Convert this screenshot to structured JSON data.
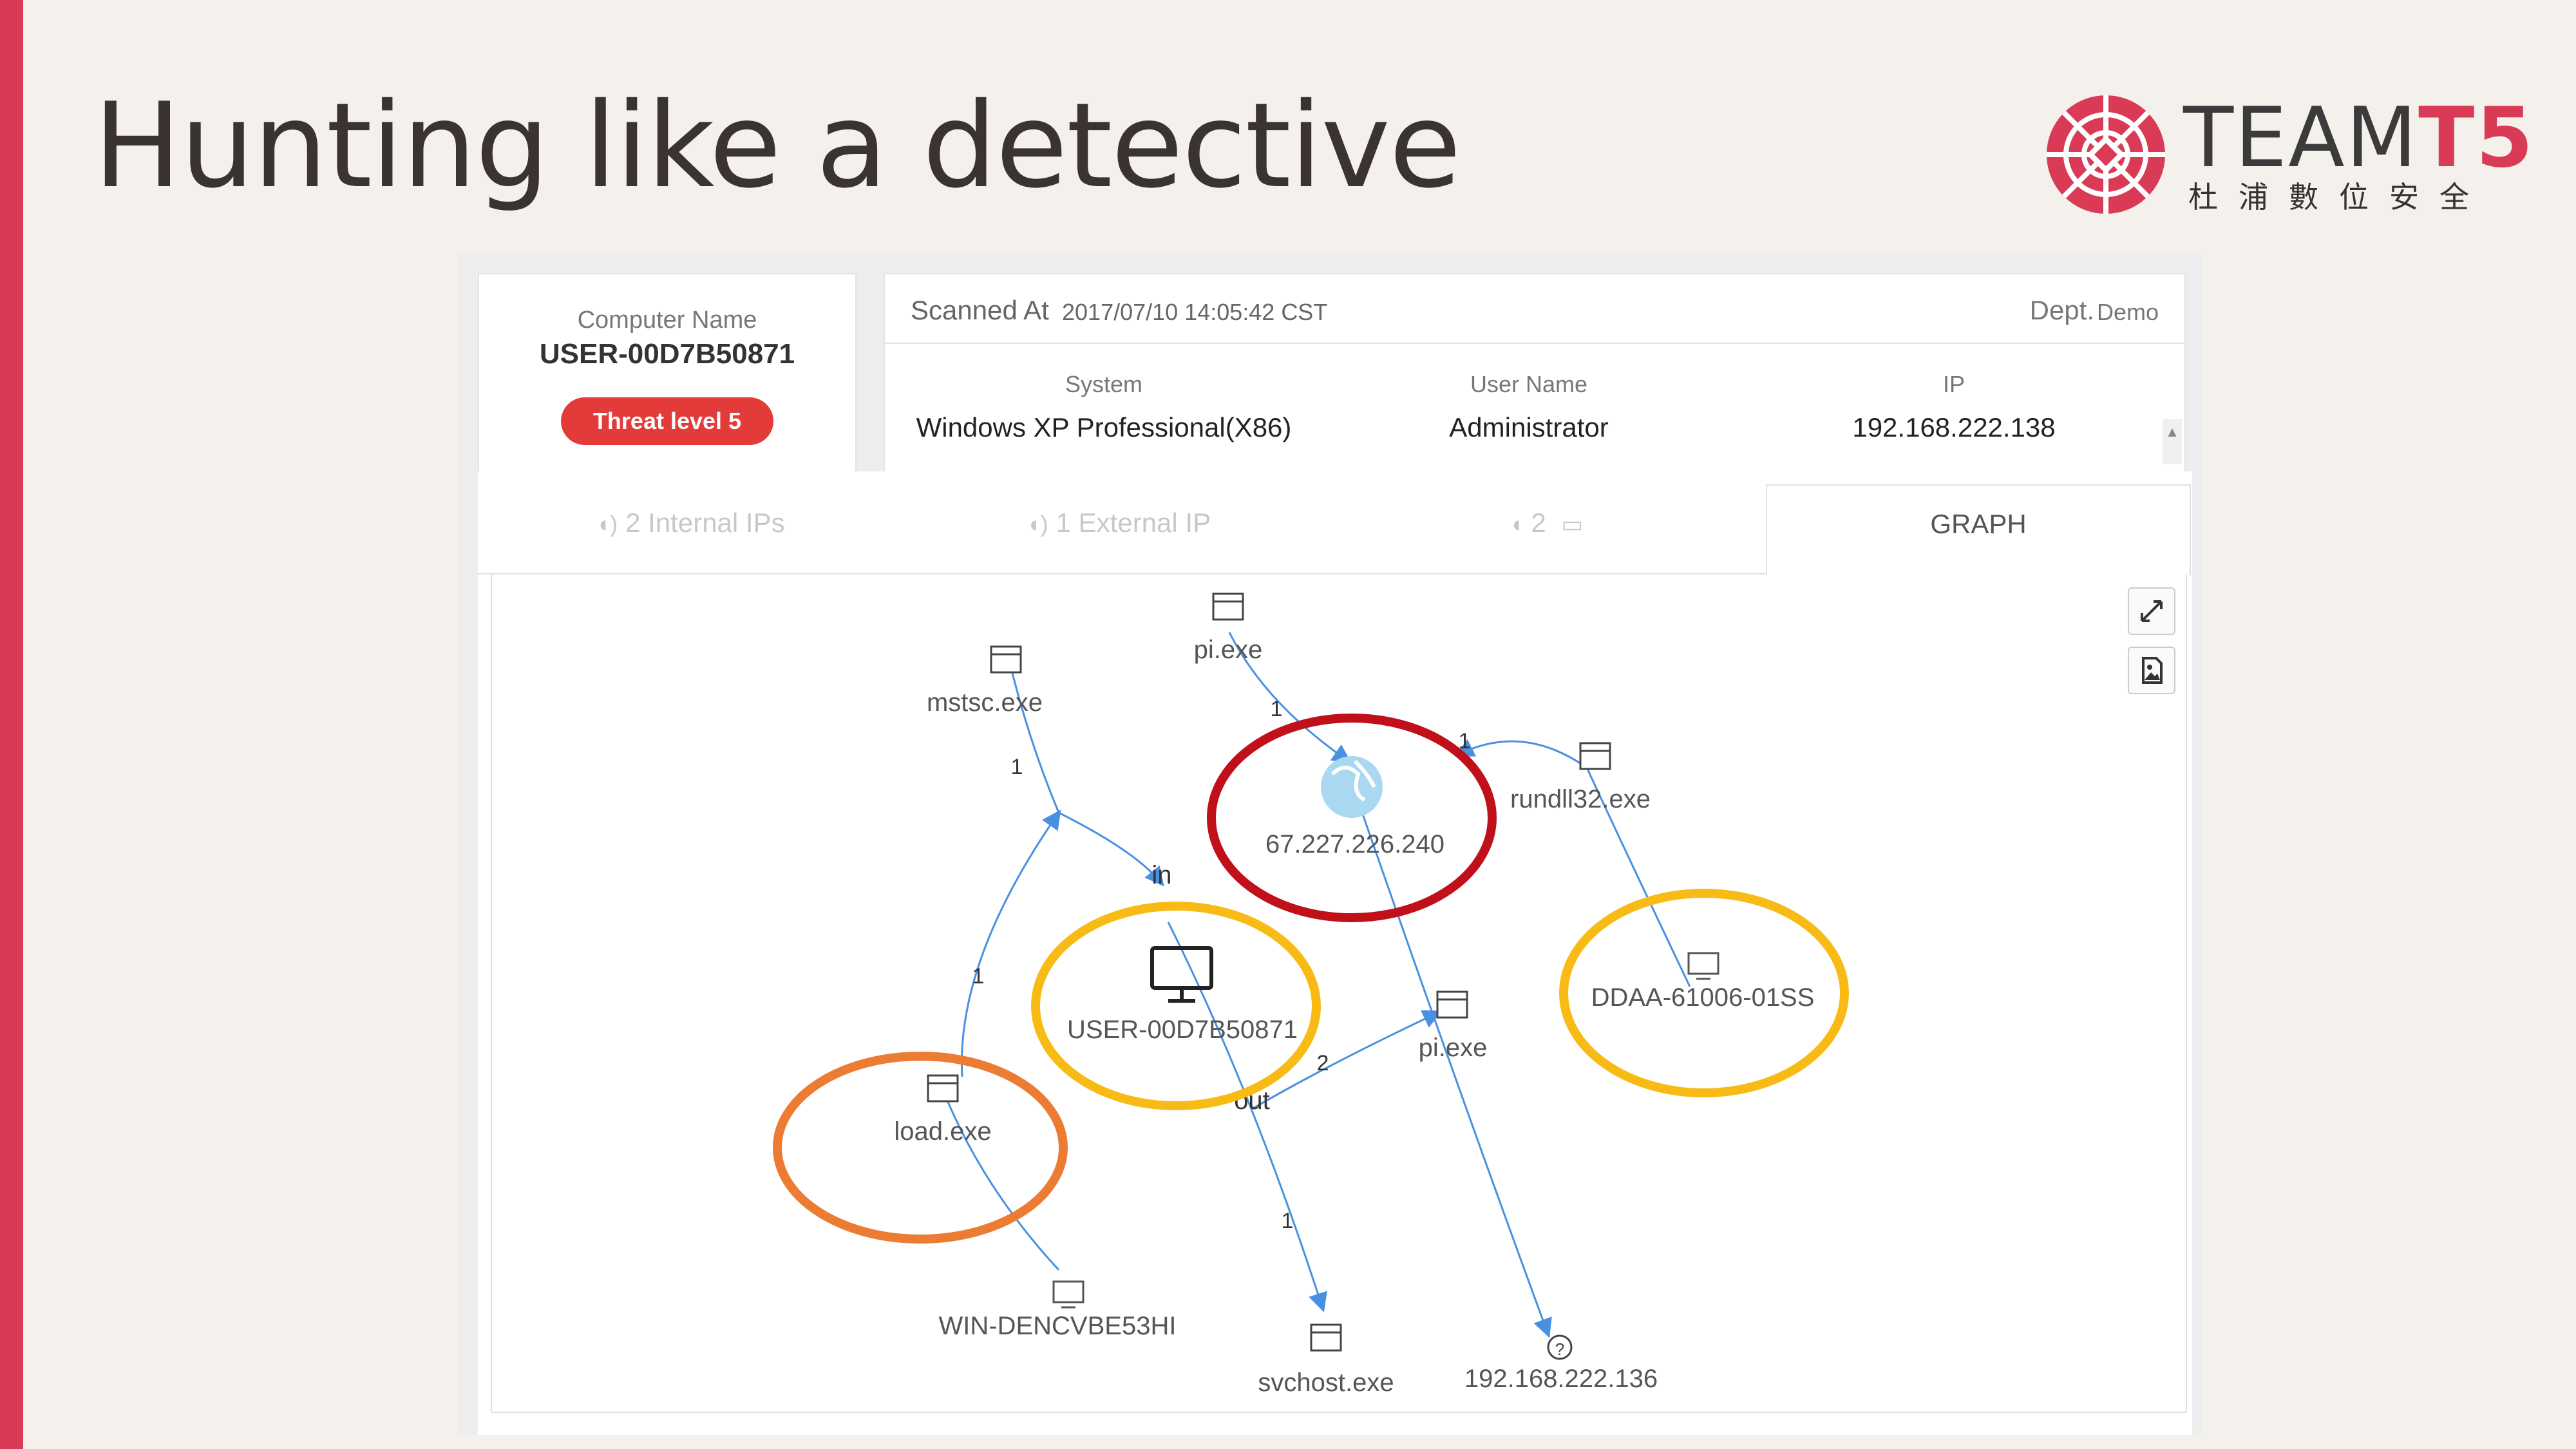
{
  "slide": {
    "title": "Hunting like a detective"
  },
  "logo": {
    "brand_main": "TEAM",
    "brand_accent": "T5",
    "subtitle": "杜浦數位安全"
  },
  "computer": {
    "name_label": "Computer Name",
    "name_value": "USER-00D7B50871",
    "threat_badge": "Threat level 5"
  },
  "scan": {
    "scanned_label": "Scanned At",
    "scanned_value": "2017/07/10 14:05:42 CST",
    "dept_label": "Dept.",
    "dept_value": "Demo"
  },
  "system_info": {
    "system_label": "System",
    "system_value": "Windows XP Professional(X86)",
    "user_label": "User Name",
    "user_value": "Administrator",
    "ip_label": "IP",
    "ip_value": "192.168.222.138"
  },
  "tabs": [
    {
      "label": "2 Internal IPs"
    },
    {
      "label": "1 External IP"
    },
    {
      "label": "2"
    },
    {
      "label": "GRAPH",
      "active": true
    }
  ],
  "graph": {
    "nodes": [
      {
        "id": "pi1",
        "label": "pi.exe",
        "type": "process"
      },
      {
        "id": "mstsc",
        "label": "mstsc.exe",
        "type": "process"
      },
      {
        "id": "ext",
        "label": "67.227.226.240",
        "type": "external-ip",
        "highlight": "#c0101a"
      },
      {
        "id": "rundll",
        "label": "rundll32.exe",
        "type": "process"
      },
      {
        "id": "ddaa",
        "label": "DDAA-61006-01SS",
        "type": "computer",
        "highlight": "#f8bb16"
      },
      {
        "id": "user",
        "label": "USER-00D7B50871",
        "type": "computer-main",
        "highlight": "#f8bb16"
      },
      {
        "id": "pi2",
        "label": "pi.exe",
        "type": "process"
      },
      {
        "id": "load",
        "label": "load.exe",
        "type": "process",
        "highlight": "#ec7b34"
      },
      {
        "id": "win",
        "label": "WIN-DENCVBE53HI",
        "type": "computer"
      },
      {
        "id": "svchost",
        "label": "svchost.exe",
        "type": "process"
      },
      {
        "id": "ip136",
        "label": "192.168.222.136",
        "type": "unknown"
      }
    ],
    "edge_labels": {
      "in": "in",
      "out": "out",
      "e1": "1",
      "e2": "2"
    }
  }
}
